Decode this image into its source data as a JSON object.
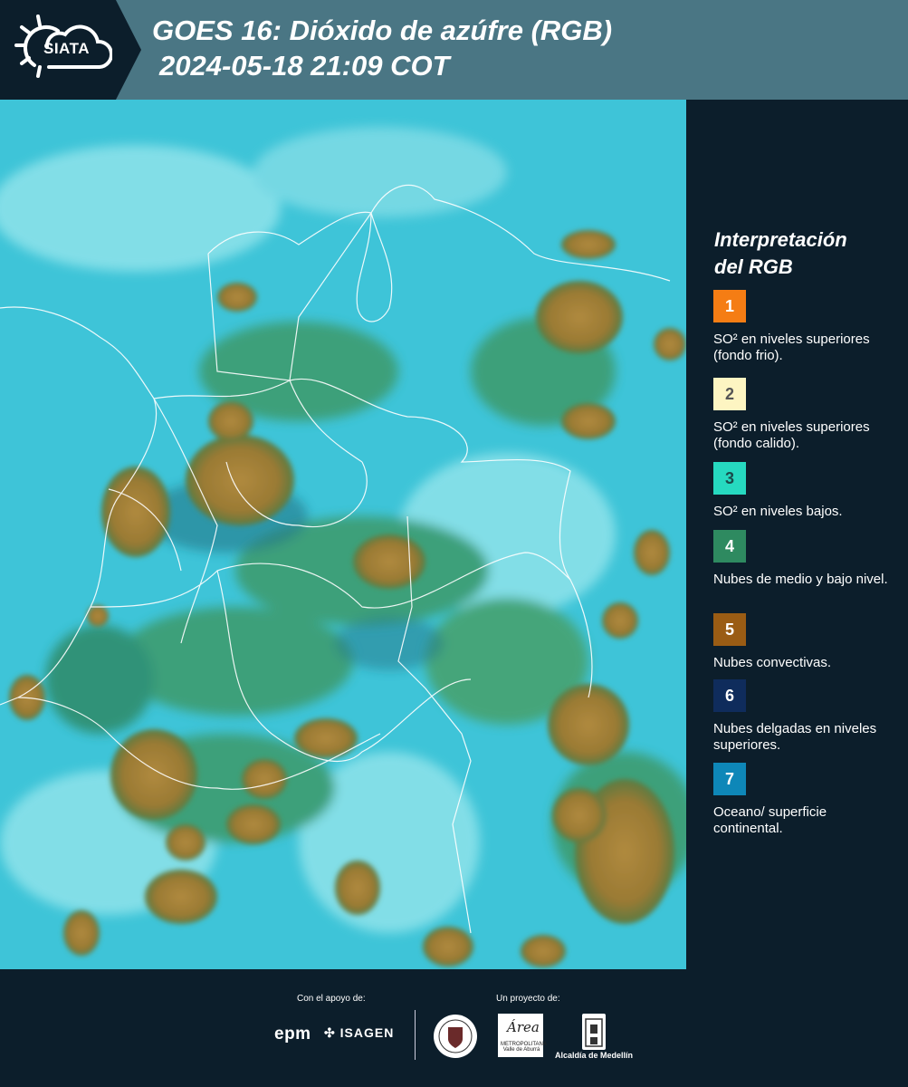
{
  "header": {
    "logo_text": "SIATA",
    "title_line1": "GOES 16: Dióxido de azúfre (RGB)",
    "title_line2": "2024-05-18 21:09 COT"
  },
  "legend": {
    "title_line1": "Interpretación",
    "title_line2": "del RGB",
    "items": [
      {
        "number": "1",
        "color": "#f57d14",
        "label": "SO² en niveles superiores (fondo frio)."
      },
      {
        "number": "2",
        "color": "#fdf5c2",
        "label": "SO² en niveles superiores (fondo calido)."
      },
      {
        "number": "3",
        "color": "#26d9c0",
        "label": "SO² en niveles bajos."
      },
      {
        "number": "4",
        "color": "#2e8a60",
        "label": "Nubes de medio y bajo nivel."
      },
      {
        "number": "5",
        "color": "#9a5c14",
        "label": "Nubes convectivas."
      },
      {
        "number": "6",
        "color": "#0f2c5c",
        "label": "Nubes delgadas en niveles superiores."
      },
      {
        "number": "7",
        "color": "#0e87b8",
        "label": "Oceano/ superficie continental."
      }
    ]
  },
  "footer": {
    "support_label": "Con el apoyo de:",
    "project_label": "Un proyecto de:",
    "sponsor1": "epm",
    "sponsor2": "ISAGEN",
    "area_logo_text": "METROPOLITANA Valle de Aburrá",
    "area_logo_name": "Área",
    "alcaldia": "Alcaldía de Medellín"
  },
  "colors": {
    "background": "#0c1e2b",
    "header": "#4a7684",
    "ocean": "#3ec4d8",
    "convective": "#9a7a3a",
    "low_cloud": "#3d9a6a"
  },
  "icons": [
    "sun-icon",
    "cloud-icon",
    "seal-icon",
    "building-icon",
    "isagen-icon"
  ]
}
